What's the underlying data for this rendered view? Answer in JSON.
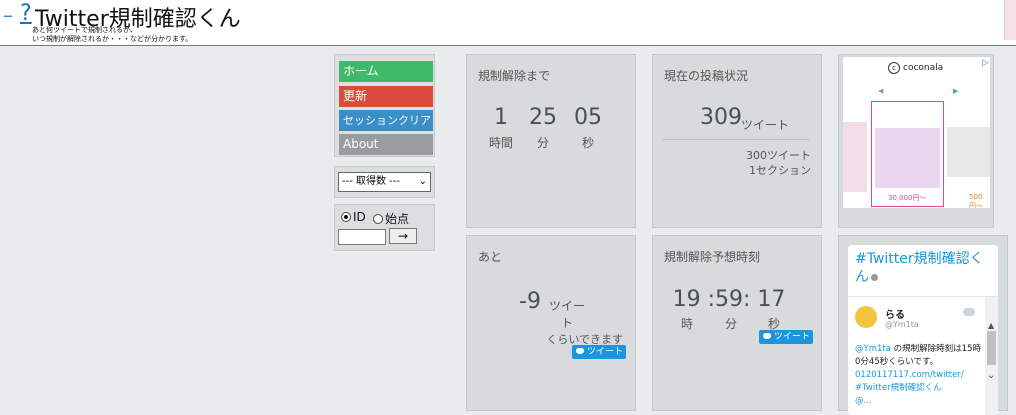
{
  "header": {
    "q_link": "?",
    "title": "Twitter規制確認くん",
    "subtitle_line1": "あと何ツイートで規制されるか、",
    "subtitle_line2": "いつ規制が解除されるか・・・などが分かります。"
  },
  "menu": {
    "home": "ホーム",
    "update": "更新",
    "session_clear": "セッションクリア",
    "about": "About"
  },
  "colors": {
    "home": "#3fba6a",
    "update": "#dc4a3c",
    "session_clear": "#3a8fc8",
    "about": "#9a9d9f"
  },
  "fetch_select": {
    "selected": "--- 取得数 ---"
  },
  "id_form": {
    "radio_id": "ID",
    "radio_start": "始点",
    "go": "→"
  },
  "countdown": {
    "title": "規制解除まで",
    "hours": "1",
    "minutes": "25",
    "seconds": "05",
    "hours_unit": "時間",
    "minutes_unit": "分",
    "seconds_unit": "秒"
  },
  "status": {
    "title": "現在の投稿状況",
    "count": "309",
    "count_unit": "ツイート",
    "limit": "300ツイート",
    "section": "1セクション"
  },
  "remaining": {
    "title": "あと",
    "value": "-9",
    "unit": "ツイート",
    "note": "くらいできます",
    "tweet_button": "ツイート"
  },
  "forecast": {
    "title": "規制解除予想時刻",
    "time": "19 :59: 17",
    "h_unit": "時",
    "m_unit": "分",
    "s_unit": "秒",
    "tweet_button": "ツイート"
  },
  "ad": {
    "brand": "coconala",
    "price1": "30,000円〜",
    "price2": "500円〜"
  },
  "timeline": {
    "title": "#Twitter規制確認くん",
    "user_name": "らる",
    "user_handle": "@Ym1ta",
    "mention": "@Ym1ta",
    "text": " の規制解除時刻は15時0分45秒くらいです。",
    "link": "0120117117.com/twitter/",
    "hashtag": "#Twitter規制確認くん",
    "more": "@..."
  }
}
